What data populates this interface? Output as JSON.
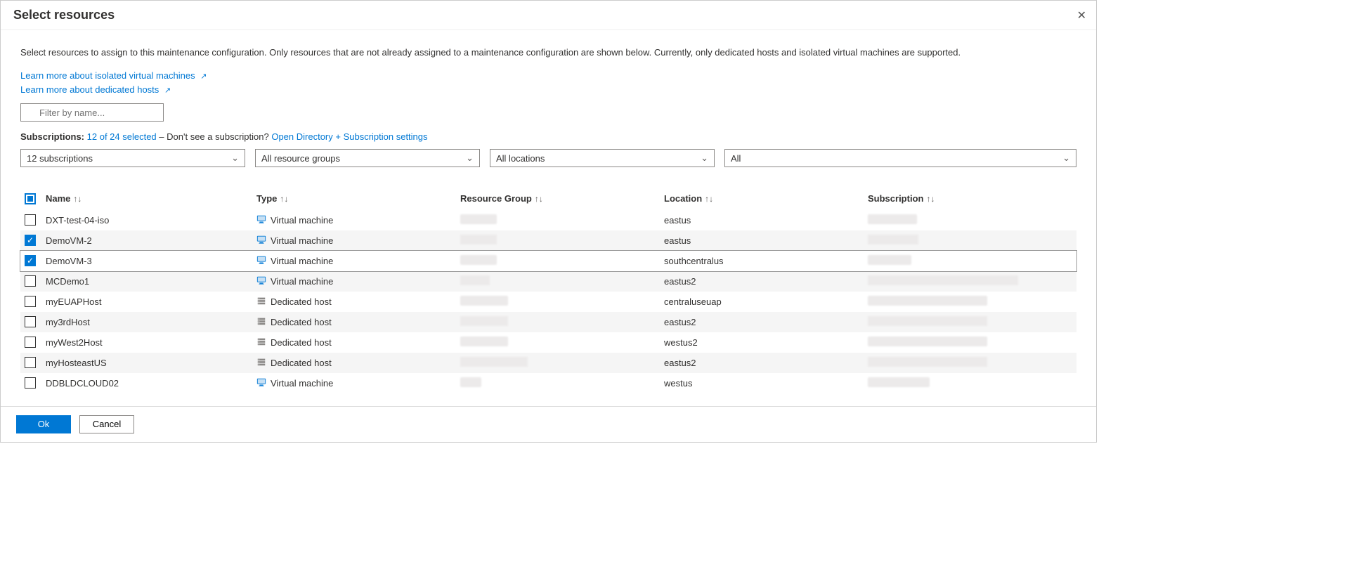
{
  "header": {
    "title": "Select resources"
  },
  "intro": "Select resources to assign to this maintenance configuration. Only resources that are not already assigned to a maintenance configuration are shown below. Currently, only dedicated hosts and isolated virtual machines are supported.",
  "links": {
    "isolatedVMs": "Learn more about isolated virtual machines",
    "dedicatedHosts": "Learn more about dedicated hosts"
  },
  "filter": {
    "placeholder": "Filter by name..."
  },
  "subscriptions": {
    "label": "Subscriptions:",
    "selectedText": "12 of 24 selected",
    "middle": " – Don't see a subscription? ",
    "dirLink": "Open Directory + Subscription settings"
  },
  "dropdowns": {
    "subs": "12 subscriptions",
    "rg": "All resource groups",
    "loc": "All locations",
    "type": "All"
  },
  "columns": {
    "name": "Name",
    "type": "Type",
    "rg": "Resource Group",
    "loc": "Location",
    "sub": "Subscription"
  },
  "types": {
    "vm": "Virtual machine",
    "host": "Dedicated host"
  },
  "rows": [
    {
      "checked": false,
      "name": "DXT-test-04-iso",
      "type": "vm",
      "rgW": 52,
      "loc": "eastus",
      "subW": 70
    },
    {
      "checked": true,
      "name": "DemoVM-2",
      "type": "vm",
      "rgW": 52,
      "loc": "eastus",
      "subW": 72
    },
    {
      "checked": true,
      "name": "DemoVM-3",
      "type": "vm",
      "rgW": 52,
      "loc": "southcentralus",
      "subW": 62,
      "highlight": true
    },
    {
      "checked": false,
      "name": "MCDemo1",
      "type": "vm",
      "rgW": 42,
      "loc": "eastus2",
      "subW": 214
    },
    {
      "checked": false,
      "name": "myEUAPHost",
      "type": "host",
      "rgW": 68,
      "loc": "centraluseuap",
      "subW": 170
    },
    {
      "checked": false,
      "name": "my3rdHost",
      "type": "host",
      "rgW": 68,
      "loc": "eastus2",
      "subW": 170
    },
    {
      "checked": false,
      "name": "myWest2Host",
      "type": "host",
      "rgW": 68,
      "loc": "westus2",
      "subW": 170
    },
    {
      "checked": false,
      "name": "myHosteastUS",
      "type": "host",
      "rgW": 96,
      "loc": "eastus2",
      "subW": 170
    },
    {
      "checked": false,
      "name": "DDBLDCLOUD02",
      "type": "vm",
      "rgW": 30,
      "loc": "westus",
      "subW": 88
    }
  ],
  "footer": {
    "ok": "Ok",
    "cancel": "Cancel"
  }
}
